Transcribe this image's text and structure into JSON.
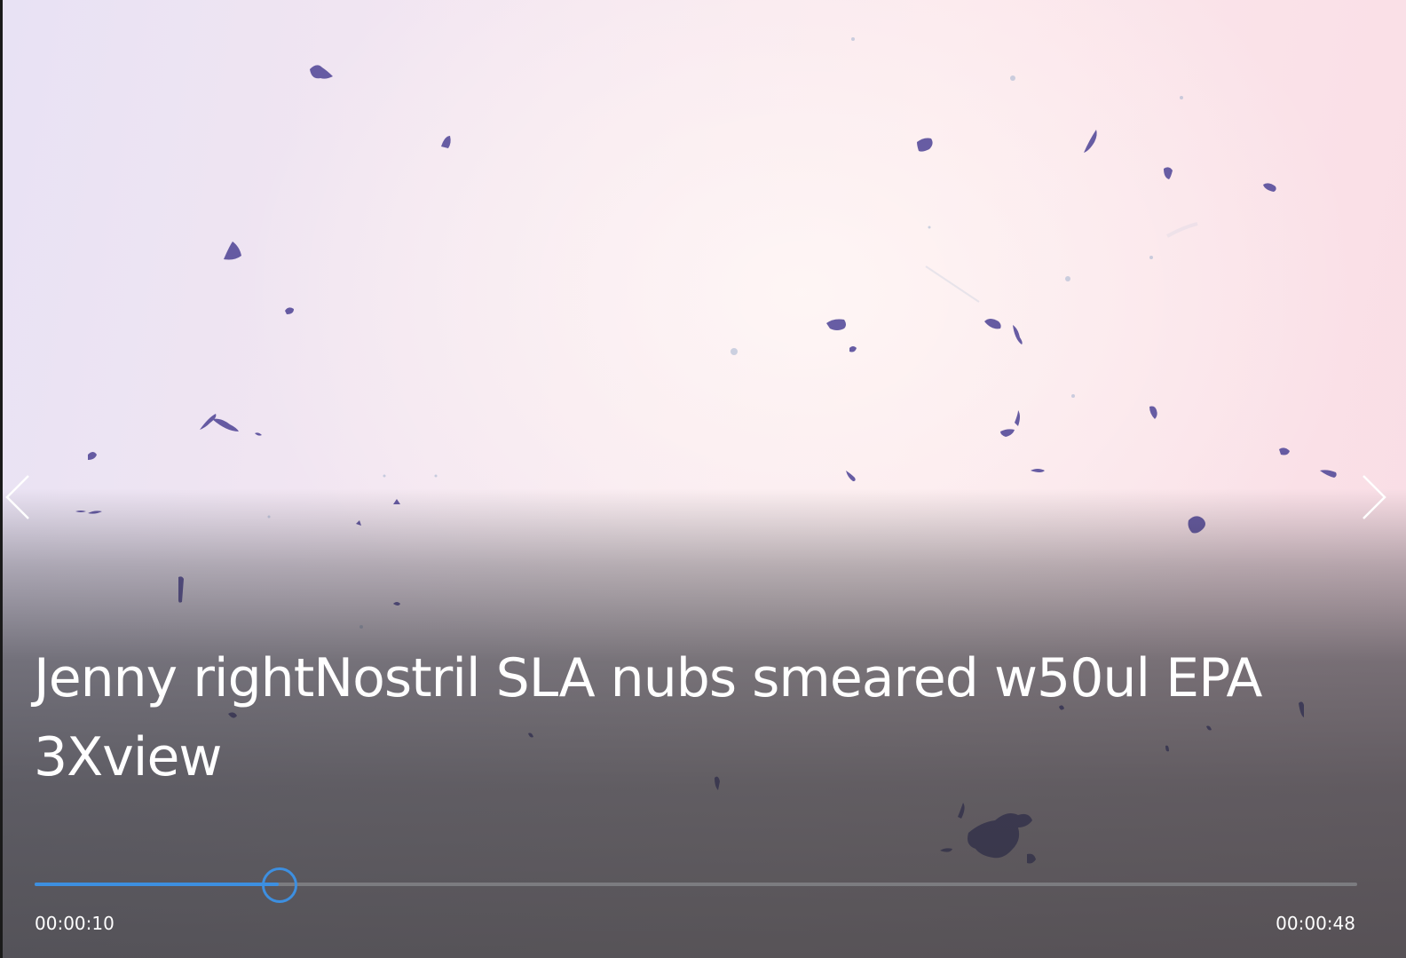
{
  "media": {
    "title": "Jenny rightNostril SLA nubs smeared w50ul EPA 3Xview",
    "elapsed": "00:00:10",
    "duration": "00:00:48",
    "progress": 0.1847
  },
  "navigation": {
    "previous_icon": "chevron-left-icon",
    "next_icon": "chevron-right-icon"
  },
  "colors": {
    "accent": "#3d8fe0",
    "track": "#7c7c80",
    "text": "#ffffff"
  }
}
